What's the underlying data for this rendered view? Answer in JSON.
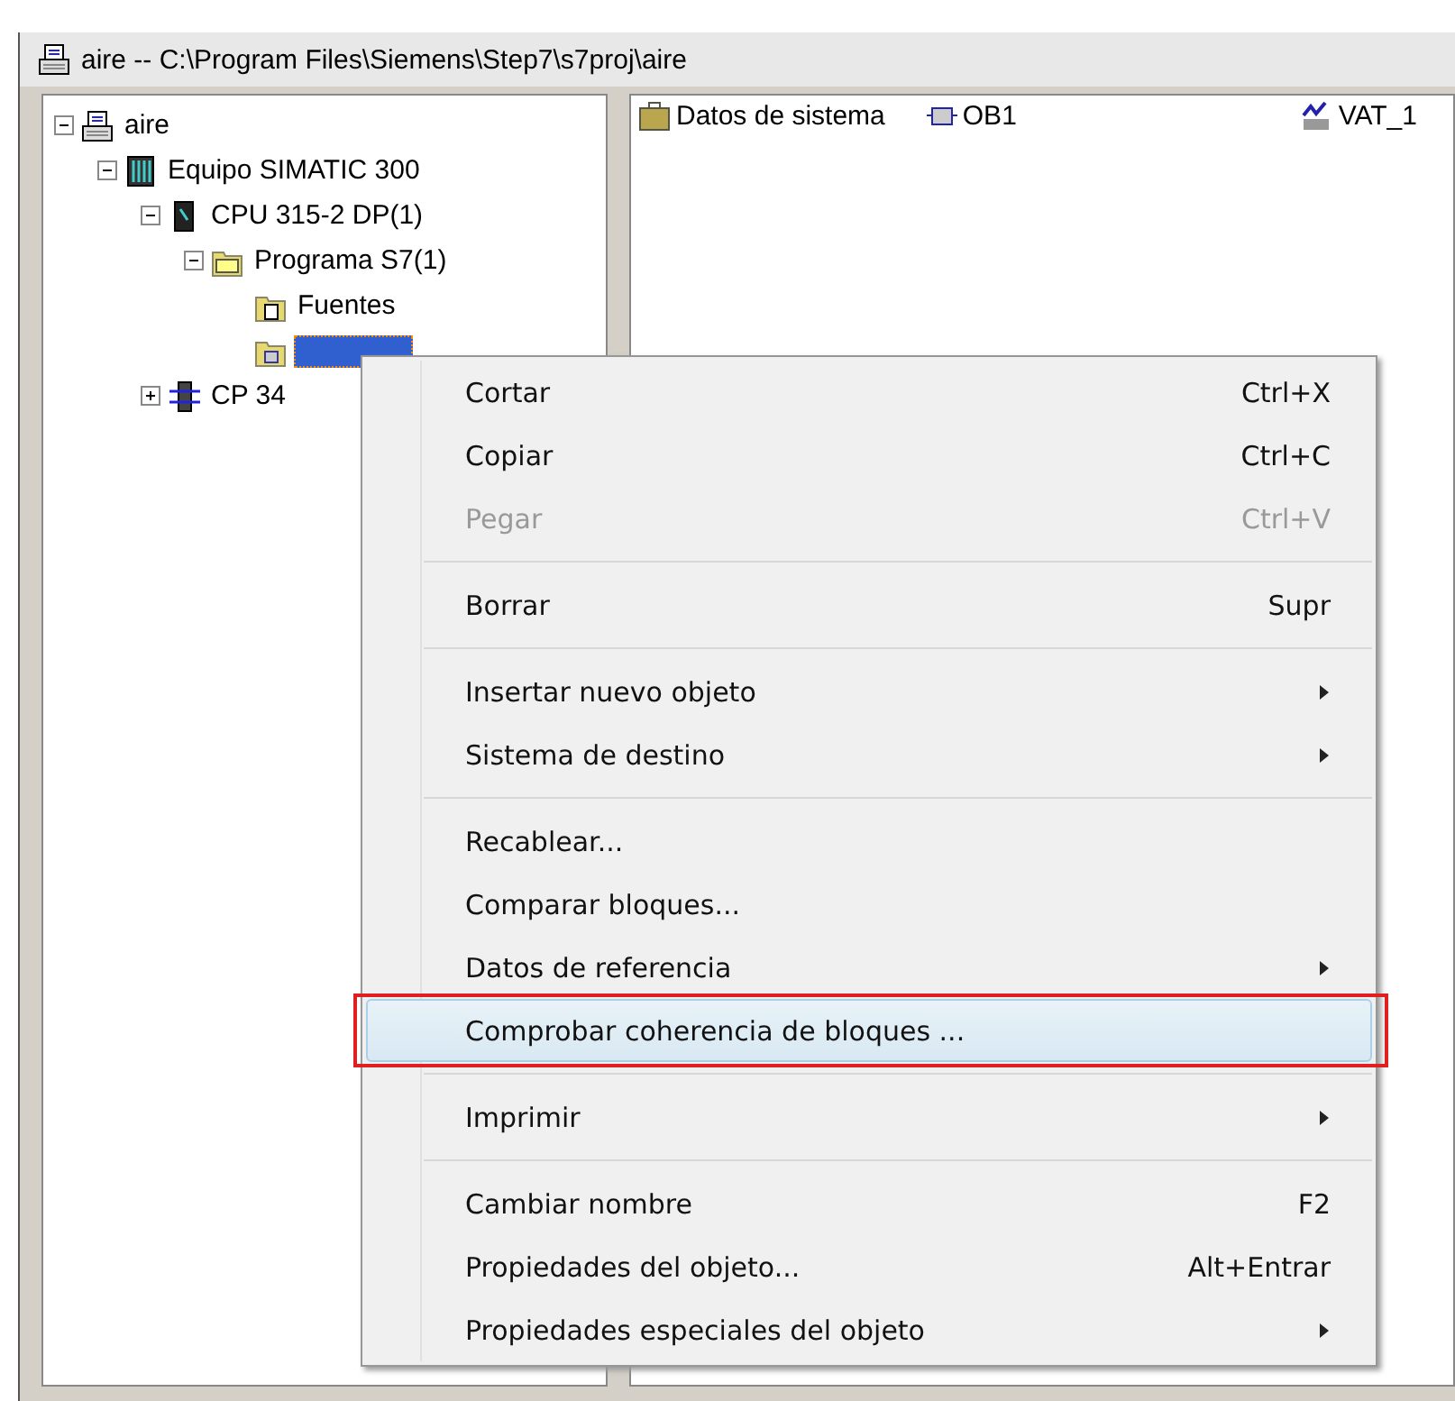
{
  "window": {
    "title": "aire -- C:\\Program Files\\Siemens\\Step7\\s7proj\\aire"
  },
  "tree": [
    {
      "label": "aire",
      "kind": "project",
      "expanded": true,
      "selected": false,
      "children": [
        {
          "label": "Equipo SIMATIC 300",
          "kind": "station",
          "expanded": true,
          "selected": false,
          "children": [
            {
              "label": "CPU 315-2 DP(1)",
              "kind": "cpu",
              "expanded": true,
              "selected": false,
              "children": [
                {
                  "label": "Programa S7(1)",
                  "kind": "program",
                  "expanded": true,
                  "selected": false,
                  "children": [
                    {
                      "label": "Fuentes",
                      "kind": "sources",
                      "selected": false
                    },
                    {
                      "kind": "blocks",
                      "selected": true
                    }
                  ]
                }
              ]
            },
            {
              "label": "CP 34",
              "kind": "cp",
              "expanded": false,
              "selected": false
            }
          ]
        }
      ]
    }
  ],
  "objects": [
    {
      "label": "Datos de sistema",
      "kind": "system"
    },
    {
      "label": "OB1",
      "kind": "block"
    },
    {
      "label": "VAT_1",
      "kind": "vat"
    }
  ],
  "menu": [
    {
      "kind": "item",
      "label": "Cortar",
      "shortcut": "Ctrl+X",
      "disabled": false,
      "selected": false
    },
    {
      "kind": "item",
      "label": "Copiar",
      "shortcut": "Ctrl+C",
      "disabled": false,
      "selected": false
    },
    {
      "kind": "item",
      "label": "Pegar",
      "shortcut": "Ctrl+V",
      "disabled": true,
      "selected": false
    },
    {
      "kind": "separator"
    },
    {
      "kind": "item",
      "label": "Borrar",
      "shortcut": "Supr",
      "disabled": false,
      "selected": false
    },
    {
      "kind": "separator"
    },
    {
      "kind": "submenu",
      "label": "Insertar nuevo objeto",
      "disabled": false,
      "selected": false
    },
    {
      "kind": "submenu",
      "label": "Sistema de destino",
      "disabled": false,
      "selected": false
    },
    {
      "kind": "separator"
    },
    {
      "kind": "item",
      "label": "Recablear...",
      "disabled": false,
      "selected": false
    },
    {
      "kind": "item",
      "label": "Comparar bloques...",
      "disabled": false,
      "selected": false
    },
    {
      "kind": "submenu",
      "label": "Datos de referencia",
      "disabled": false,
      "selected": false
    },
    {
      "kind": "item",
      "label": "Comprobar coherencia de bloques ...",
      "disabled": false,
      "selected": true,
      "outlined": true
    },
    {
      "kind": "separator"
    },
    {
      "kind": "submenu",
      "label": "Imprimir",
      "disabled": false,
      "selected": false
    },
    {
      "kind": "separator"
    },
    {
      "kind": "item",
      "label": "Cambiar nombre",
      "shortcut": "F2",
      "disabled": false,
      "selected": false
    },
    {
      "kind": "item",
      "label": "Propiedades del objeto...",
      "shortcut": "Alt+Entrar",
      "disabled": false,
      "selected": false
    },
    {
      "kind": "submenu",
      "label": "Propiedades especiales del objeto",
      "disabled": false,
      "selected": false
    }
  ]
}
